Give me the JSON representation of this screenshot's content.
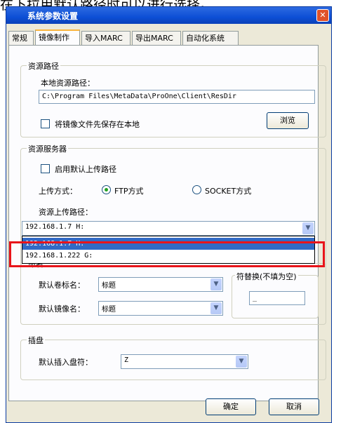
{
  "caption": "在下拉用默认路径时可以进行选择。",
  "window": {
    "title": "系统参数设置",
    "close_glyph": "✕"
  },
  "tabs": [
    {
      "label": "常规",
      "active": false
    },
    {
      "label": "镜像制作",
      "active": true
    },
    {
      "label": "导入MARC",
      "active": false
    },
    {
      "label": "导出MARC",
      "active": false
    },
    {
      "label": "自动化系统",
      "active": false
    }
  ],
  "resource_path": {
    "group_title": "资源路径",
    "local_label": "本地资源路径：",
    "local_value": "C:\\Program Files\\MetaData\\ProOne\\Client\\ResDir",
    "save_local_label": "将镜像文件先保存在本地",
    "save_local_checked": false,
    "browse_label": "浏览"
  },
  "resource_server": {
    "group_title": "资源服务器",
    "enable_default_label": "启用默认上传路径",
    "enable_default_checked": false,
    "upload_mode_label": "上传方式：",
    "ftp_label": "FTP方式",
    "ftp_selected": true,
    "socket_label": "SOCKET方式",
    "socket_selected": false,
    "upload_path_label": "资源上传路径：",
    "upload_path_value": "192.168.1.7 H:",
    "dropdown_options": [
      "192.168.1.7 H:",
      "192.168.1.222 G:"
    ],
    "selected_option_index": 0
  },
  "naming": {
    "group_title": "命名",
    "volume_label": "默认卷标名：",
    "volume_value": "标题",
    "image_label": "默认镜像名：",
    "image_value": "标题",
    "replace_title": "符替换(不填为空)",
    "replace_value": "_"
  },
  "insert_drive": {
    "group_title": "插盘",
    "drive_label": "默认插入盘符：",
    "drive_value": "Z"
  },
  "footer": {
    "ok_label": "确定",
    "cancel_label": "取消"
  },
  "icons": {
    "dropdown": "chevron-down-icon",
    "close": "close-icon"
  },
  "colors": {
    "title_bar": "#0d4fd6",
    "highlight": "#e8141a",
    "selection": "#316ac5"
  }
}
